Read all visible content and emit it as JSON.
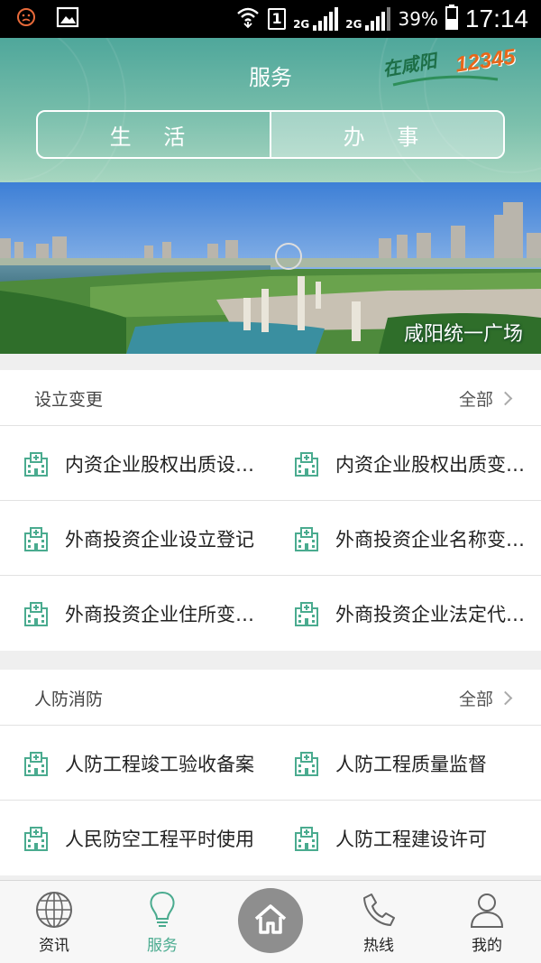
{
  "status_bar": {
    "sim_slot": "1",
    "network_1": "2G",
    "network_2": "2G",
    "battery": "39%",
    "time": "17:14"
  },
  "header": {
    "title": "服务",
    "brand": {
      "text": "在咸阳",
      "number": "12345"
    },
    "tabs": [
      {
        "label": "生 活",
        "active": true
      },
      {
        "label": "办 事",
        "active": false
      }
    ]
  },
  "banner": {
    "caption": "咸阳统一广场"
  },
  "sections": [
    {
      "title": "设立变更",
      "more_label": "全部",
      "items": [
        "内资企业股权出质设…",
        "内资企业股权出质变…",
        "外商投资企业设立登记",
        "外商投资企业名称变…",
        "外商投资企业住所变…",
        "外商投资企业法定代…"
      ]
    },
    {
      "title": "人防消防",
      "more_label": "全部",
      "items": [
        "人防工程竣工验收备案",
        "人防工程质量监督",
        "人民防空工程平时使用",
        "人防工程建设许可"
      ]
    }
  ],
  "bottom_nav": {
    "items": [
      {
        "label": "资讯",
        "icon": "globe-icon",
        "active": false
      },
      {
        "label": "服务",
        "icon": "lightbulb-icon",
        "active": true
      },
      {
        "label": "",
        "icon": "home-icon",
        "active": false
      },
      {
        "label": "热线",
        "icon": "phone-icon",
        "active": false
      },
      {
        "label": "我的",
        "icon": "user-icon",
        "active": false
      }
    ]
  },
  "colors": {
    "accent": "#4aab8f",
    "header_top": "#4fa79b",
    "header_bottom": "#a7d6c0",
    "brand_orange": "#e8671a"
  }
}
